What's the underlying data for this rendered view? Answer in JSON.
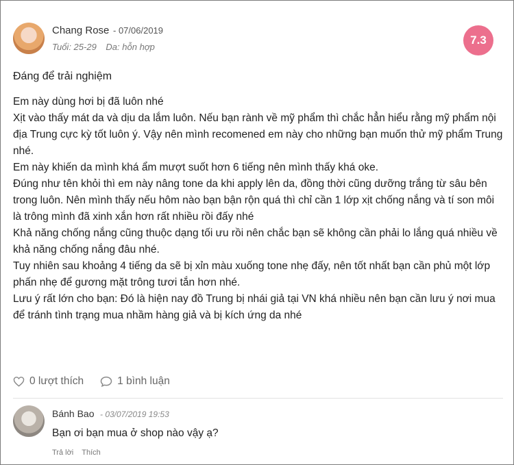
{
  "review": {
    "author": "Chang Rose",
    "date": "- 07/06/2019",
    "age": "Tuổi: 25-29",
    "skin": "Da: hỗn hợp",
    "score": "7.3",
    "title": "Đáng để trải nghiệm",
    "paragraphs": [
      "Em này dùng hơi bị đã luôn nhé",
      "Xịt vào thấy mát da và dịu da lắm luôn. Nếu bạn rành về mỹ phẩm thì chắc hẳn hiểu rằng mỹ phẩm nội địa Trung cực kỳ tốt luôn ý. Vậy nên mình recomened em này cho những bạn muốn thử mỹ phẩm Trung nhé.",
      "Em này khiến da mình khá ẩm mượt suốt hơn 6 tiếng nên mình thấy khá oke.",
      "Đúng như tên khỏi thì em này nâng tone da khi apply lên da, đồng thời cũng dưỡng trắng từ sâu bên trong luôn. Nên mình thấy nếu hôm nào bạn bận rộn quá thì chỉ cần 1 lớp xịt chống nắng và tí son môi là trông mình đã xinh xắn hơn rất nhiều rồi đấy nhé",
      "Khả năng chống nắng cũng thuộc dạng tối ưu rồi nên chắc bạn sẽ không cần phải lo lắng quá nhiều về khả năng chống nắng đâu nhé.",
      "Tuy nhiên sau khoảng 4 tiếng da sẽ bị xỉn màu xuống tone nhẹ đấy, nên tốt nhất bạn cần phủ một lớp phấn nhẹ để gương mặt trông tươi tắn hơn nhé.",
      "Lưu ý rất lớn cho bạn: Đó là hiện nay đồ Trung bị nhái giả tại VN khá nhiều nên bạn cần lưu ý nơi mua để tránh tình trạng mua nhầm hàng giả và bị kích ứng da nhé"
    ],
    "likes": "0 lượt thích",
    "comments": "1 bình luận"
  },
  "comment": {
    "author": "Bánh Bao",
    "date": "- 03/07/2019 19:53",
    "text": "Bạn ơi bạn mua ở shop nào vậy ạ?",
    "reply": "Trả lời",
    "like": "Thích"
  },
  "colors": {
    "score_badge": "#ec6f8d",
    "text": "#222222",
    "muted": "#666666"
  },
  "icons": {
    "like": "heart-icon",
    "comment": "speech-bubble-icon"
  }
}
